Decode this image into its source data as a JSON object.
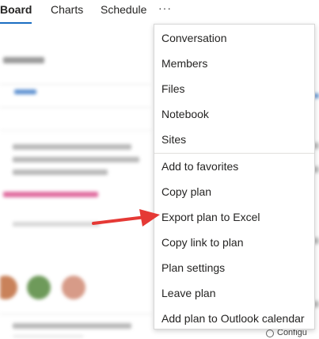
{
  "topnav": {
    "tabs": [
      {
        "label": "Board",
        "active": true
      },
      {
        "label": "Charts",
        "active": false
      },
      {
        "label": "Schedule",
        "active": false
      }
    ],
    "more_icon": "ellipsis-icon",
    "more_label": "···"
  },
  "menu": {
    "group1": [
      "Conversation",
      "Members",
      "Files",
      "Notebook",
      "Sites"
    ],
    "group2": [
      "Add to favorites",
      "Copy plan",
      "Export plan to Excel",
      "Copy link to plan",
      "Plan settings",
      "Leave plan",
      "Add plan to Outlook calendar"
    ],
    "highlighted_item": "Export plan to Excel"
  },
  "footer": {
    "partial_label": "Configu"
  },
  "colors": {
    "accent": "#1b6ec2",
    "annotation_arrow": "#e53935",
    "menu_border": "#d6d6d6"
  }
}
